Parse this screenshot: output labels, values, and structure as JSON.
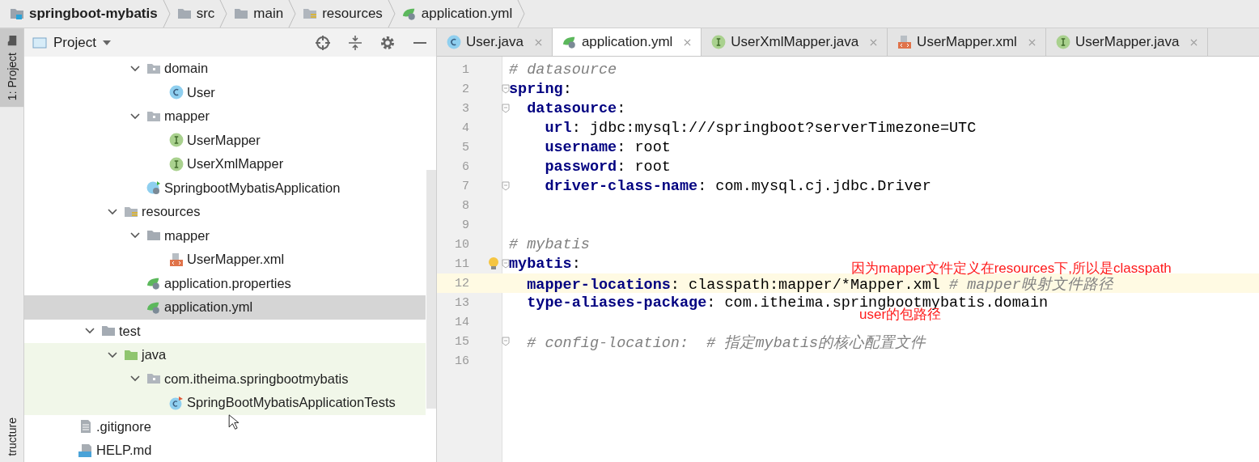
{
  "breadcrumb": [
    {
      "label": "springboot-mybatis",
      "kind": "module"
    },
    {
      "label": "src",
      "kind": "folder"
    },
    {
      "label": "main",
      "kind": "folder"
    },
    {
      "label": "resources",
      "kind": "resources"
    },
    {
      "label": "application.yml",
      "kind": "spring-config"
    }
  ],
  "tool_stripe": {
    "top": {
      "label": "1: Project",
      "selected": true
    },
    "bottom": {
      "label": "tructure",
      "selected": false
    }
  },
  "project_panel": {
    "title": "Project",
    "tree": [
      {
        "children": [
          {
            "children": [
              {
                "children": [
                  {
                    "children": [
                      {
                        "label": "domain",
                        "kind": "package",
                        "expanded": true,
                        "selected": false,
                        "children": [
                          {
                            "label": "User",
                            "kind": "class",
                            "selected": false
                          }
                        ]
                      },
                      {
                        "label": "mapper",
                        "kind": "package",
                        "expanded": true,
                        "selected": false,
                        "children": [
                          {
                            "label": "UserMapper",
                            "kind": "interface",
                            "selected": false
                          },
                          {
                            "label": "UserXmlMapper",
                            "kind": "interface",
                            "selected": false
                          }
                        ]
                      },
                      {
                        "label": "SpringbootMybatisApplication",
                        "kind": "spring-app",
                        "selected": false
                      }
                    ]
                  },
                  {
                    "label": "resources",
                    "kind": "resources",
                    "expanded": true,
                    "selected": false,
                    "children": [
                      {
                        "label": "mapper",
                        "kind": "folder",
                        "expanded": true,
                        "selected": false,
                        "children": [
                          {
                            "label": "UserMapper.xml",
                            "kind": "xml",
                            "selected": false
                          }
                        ]
                      },
                      {
                        "label": "application.properties",
                        "kind": "spring-config",
                        "selected": false
                      },
                      {
                        "label": "application.yml",
                        "kind": "spring-config",
                        "selected": true
                      }
                    ]
                  }
                ]
              },
              {
                "label": "test",
                "kind": "folder",
                "expanded": true,
                "selected": false,
                "children": [
                  {
                    "label": "java",
                    "kind": "test-root",
                    "expanded": true,
                    "selected": false,
                    "test_sources": true,
                    "children": [
                      {
                        "label": "com.itheima.springbootmybatis",
                        "kind": "package",
                        "expanded": true,
                        "selected": false,
                        "children": [
                          {
                            "label": "SpringBootMybatisApplicationTests",
                            "kind": "test-class",
                            "selected": false
                          }
                        ]
                      }
                    ]
                  }
                ]
              }
            ]
          },
          {
            "label": ".gitignore",
            "kind": "text",
            "selected": false
          },
          {
            "label": "HELP.md",
            "kind": "markdown",
            "selected": false
          }
        ]
      }
    ]
  },
  "tabs": [
    {
      "label": "User.java",
      "kind": "class",
      "selected": false
    },
    {
      "label": "application.yml",
      "kind": "spring-config",
      "selected": true
    },
    {
      "label": "UserXmlMapper.java",
      "kind": "interface",
      "selected": false
    },
    {
      "label": "UserMapper.xml",
      "kind": "xml",
      "selected": false
    },
    {
      "label": "UserMapper.java",
      "kind": "interface",
      "selected": false
    }
  ],
  "editor": {
    "lines": [
      {
        "number": "1",
        "fold": false,
        "current": false,
        "tokens": [
          {
            "kind": "comment",
            "text": "# datasource"
          }
        ]
      },
      {
        "number": "2",
        "fold": true,
        "current": false,
        "tokens": [
          {
            "kind": "key",
            "text": "spring"
          },
          {
            "kind": "punct",
            "text": ":"
          }
        ]
      },
      {
        "number": "3",
        "fold": true,
        "current": false,
        "tokens": [
          {
            "kind": "key",
            "text": "  datasource"
          },
          {
            "kind": "punct",
            "text": ":"
          }
        ]
      },
      {
        "number": "4",
        "fold": false,
        "current": false,
        "tokens": [
          {
            "kind": "key",
            "text": "    url"
          },
          {
            "kind": "punct",
            "text": ":"
          },
          {
            "kind": "value",
            "text": " jdbc:mysql:///springboot?serverTimezone=UTC"
          }
        ]
      },
      {
        "number": "5",
        "fold": false,
        "current": false,
        "tokens": [
          {
            "kind": "key",
            "text": "    username"
          },
          {
            "kind": "punct",
            "text": ":"
          },
          {
            "kind": "value",
            "text": " root"
          }
        ]
      },
      {
        "number": "6",
        "fold": false,
        "current": false,
        "tokens": [
          {
            "kind": "key",
            "text": "    password"
          },
          {
            "kind": "punct",
            "text": ":"
          },
          {
            "kind": "value",
            "text": " root"
          }
        ]
      },
      {
        "number": "7",
        "fold": true,
        "current": false,
        "tokens": [
          {
            "kind": "key",
            "text": "    driver-class-name"
          },
          {
            "kind": "punct",
            "text": ":"
          },
          {
            "kind": "value",
            "text": " com.mysql.cj.jdbc.Driver"
          }
        ]
      },
      {
        "number": "8",
        "fold": false,
        "current": false
      },
      {
        "number": "9",
        "fold": false,
        "current": false
      },
      {
        "number": "10",
        "fold": false,
        "current": false,
        "tokens": [
          {
            "kind": "comment",
            "text": "# mybatis"
          }
        ]
      },
      {
        "number": "11",
        "fold": true,
        "current": false,
        "bulb": true,
        "tokens": [
          {
            "kind": "key",
            "text": "mybatis"
          },
          {
            "kind": "punct",
            "text": ":"
          }
        ]
      },
      {
        "number": "12",
        "fold": false,
        "current": true,
        "tokens": [
          {
            "kind": "key",
            "text": "  mapper-locations"
          },
          {
            "kind": "punct",
            "text": ":"
          },
          {
            "kind": "value",
            "text": " classpath:mapper/*Mapper.xml "
          },
          {
            "kind": "comment",
            "text": "# mapper映射文件路径"
          }
        ]
      },
      {
        "number": "13",
        "fold": false,
        "current": false,
        "tokens": [
          {
            "kind": "key",
            "text": "  type-aliases-package"
          },
          {
            "kind": "punct",
            "text": ":"
          },
          {
            "kind": "value",
            "text": " com.itheima.springbootmybatis.domain"
          }
        ]
      },
      {
        "number": "14",
        "fold": false,
        "current": false
      },
      {
        "number": "15",
        "fold": true,
        "current": false,
        "tokens": [
          {
            "kind": "comment",
            "text": "  # config-location:  # 指定mybatis的核心配置文件"
          }
        ]
      },
      {
        "number": "16",
        "fold": false,
        "current": false
      }
    ],
    "annotations": [
      "因为mapper文件定义在resources下,所以是classpath",
      "user的包路径"
    ]
  }
}
